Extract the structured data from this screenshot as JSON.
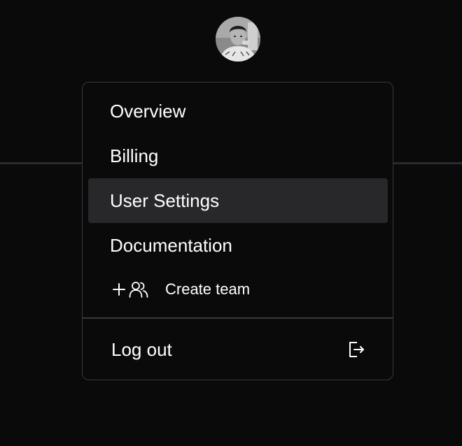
{
  "account": {
    "avatar_icon": "user-avatar-photo"
  },
  "menu": {
    "items": [
      {
        "label": "Overview",
        "active": false
      },
      {
        "label": "Billing",
        "active": false
      },
      {
        "label": "User Settings",
        "active": true
      },
      {
        "label": "Documentation",
        "active": false
      }
    ],
    "create_team": {
      "label": "Create team",
      "icons": [
        "plus-icon",
        "users-icon"
      ]
    },
    "logout": {
      "label": "Log out",
      "icon": "log-out-icon"
    }
  },
  "colors": {
    "background": "#0a0a0b",
    "menu_border": "#38383b",
    "active_item_bg": "#28282a",
    "text": "#ffffff",
    "header_divider": "#2b2b2d"
  }
}
